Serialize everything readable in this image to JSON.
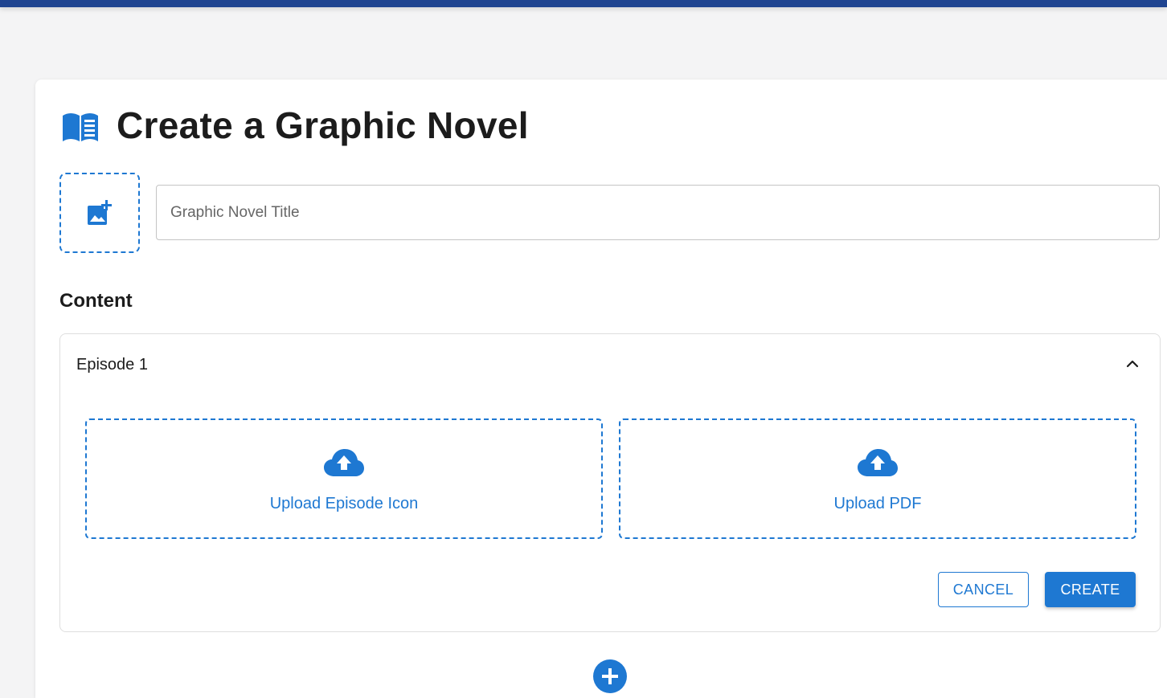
{
  "page": {
    "title": "Create a Graphic Novel",
    "title_icon": "menu-book-icon",
    "cover_upload_icon": "add-photo-icon"
  },
  "form": {
    "title_placeholder": "Graphic Novel Title",
    "title_value": ""
  },
  "content": {
    "heading": "Content",
    "episodes": [
      {
        "title": "Episode 1",
        "expanded": true,
        "upload_icon_label": "Upload Episode Icon",
        "upload_pdf_label": "Upload PDF",
        "cancel_label": "CANCEL",
        "create_label": "CREATE"
      }
    ],
    "add_episode_icon": "add-circle-icon"
  },
  "colors": {
    "accent": "#1e78d2",
    "top_bar": "#1f4490",
    "background": "#f4f4f5",
    "text": "#1c1c1c"
  }
}
